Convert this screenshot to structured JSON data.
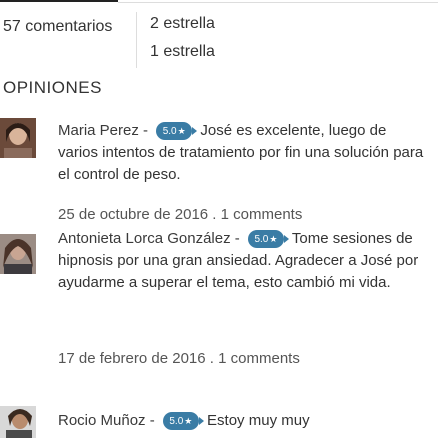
{
  "header": {
    "comments_count": "57 comentarios",
    "star_rows": [
      "2 estrella",
      "1 estrella"
    ]
  },
  "section": {
    "title": "OPINIONES"
  },
  "reviews": [
    {
      "author": "Maria Perez -",
      "badge": "5.0",
      "text": "José es excelente, luego de varios intentos de tratamiento por fin una solución para el control de peso.",
      "date": "25 de octubre de 2016",
      "separator": ".",
      "comments": "1 comments"
    },
    {
      "author": "Antonieta Lorca González -",
      "badge": "5.0",
      "text": "Tome sesiones de hipnosis por una gran ansiedad. Agradecer a José por ayudarme a superar el tema, esto cambió mi vida.",
      "date": "17 de febrero de 2016",
      "separator": ".",
      "comments": "1 comments"
    },
    {
      "author": "Rocio Muñoz -",
      "badge": "5.0",
      "text": "Estoy muy muy",
      "date": "",
      "separator": "",
      "comments": ""
    }
  ],
  "colors": {
    "badge": "#3a7ca5",
    "text": "#333333",
    "divider": "#dddddd"
  }
}
